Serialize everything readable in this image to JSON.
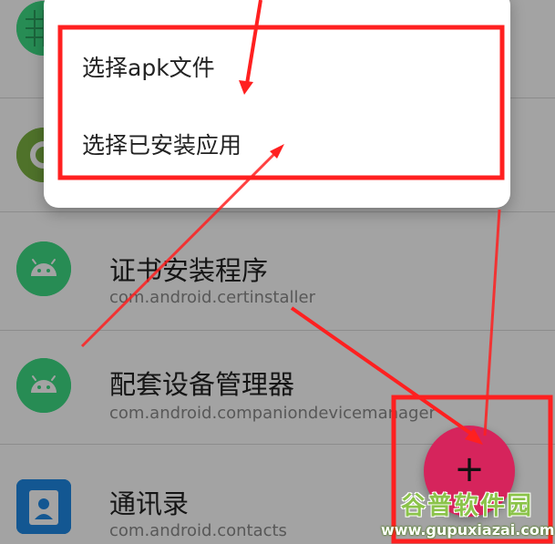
{
  "menu": {
    "items": [
      {
        "label": "选择apk文件"
      },
      {
        "label": "选择已安装应用"
      }
    ]
  },
  "apps": [
    {
      "name": "证书安装程序",
      "package": "com.android.certinstaller",
      "icon": "android-robot-icon"
    },
    {
      "name": "配套设备管理器",
      "package": "com.android.companiondevicemanager",
      "icon": "android-robot-icon"
    },
    {
      "name": "通讯录",
      "package": "com.android.contacts",
      "icon": "contacts-icon"
    }
  ],
  "fab": {
    "label": "+"
  },
  "watermark": {
    "logo": "谷普软件园",
    "url": "www.gupuxiazai.com"
  },
  "colors": {
    "android_green": "#3ddc84",
    "fab": "#d6245c",
    "annotation_red": "#ff2020",
    "contacts_blue": "#1e88e5"
  }
}
